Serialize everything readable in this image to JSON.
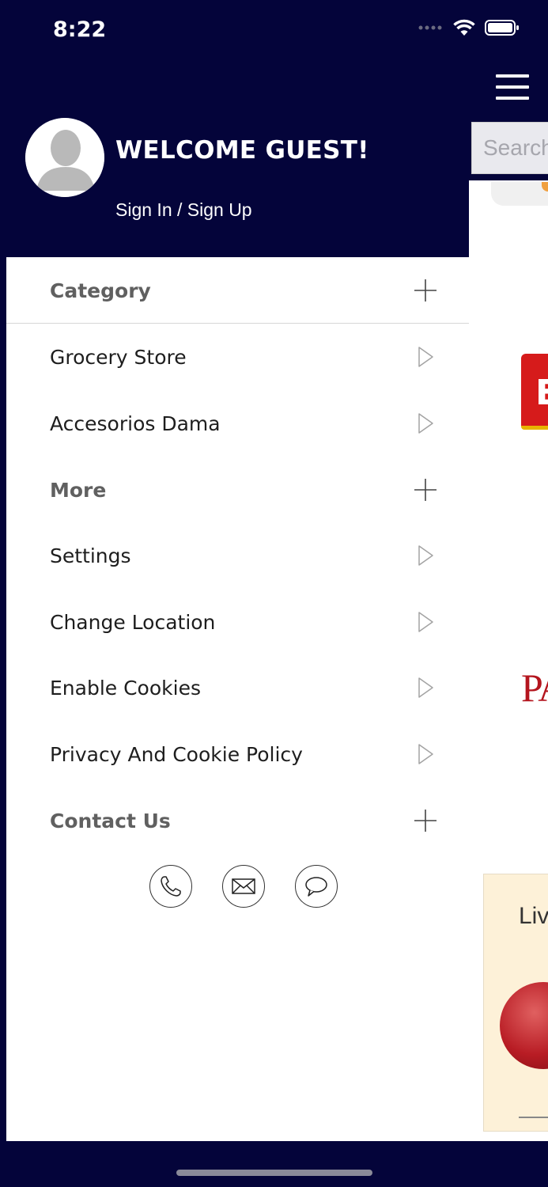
{
  "status_bar": {
    "time": "8:22"
  },
  "background_app": {
    "search_placeholder": "Search",
    "brand_letter": "E",
    "brand_text": "PA",
    "banner_text": "Live"
  },
  "drawer": {
    "welcome": "WELCOME GUEST!",
    "signin": "Sign In / Sign Up",
    "sections": {
      "category": {
        "label": "Category"
      },
      "more": {
        "label": "More"
      },
      "contact": {
        "label": "Contact Us"
      }
    },
    "items": {
      "grocery": "Grocery Store",
      "accesorios": "Accesorios Dama",
      "settings": "Settings",
      "location": "Change Location",
      "cookies": "Enable Cookies",
      "privacy": "Privacy And Cookie Policy"
    },
    "contact_icons": [
      "phone-icon",
      "mail-icon",
      "chat-icon"
    ]
  },
  "colors": {
    "header_bg": "#04043a",
    "section_text": "#606060",
    "item_text": "#1e1e1e"
  }
}
